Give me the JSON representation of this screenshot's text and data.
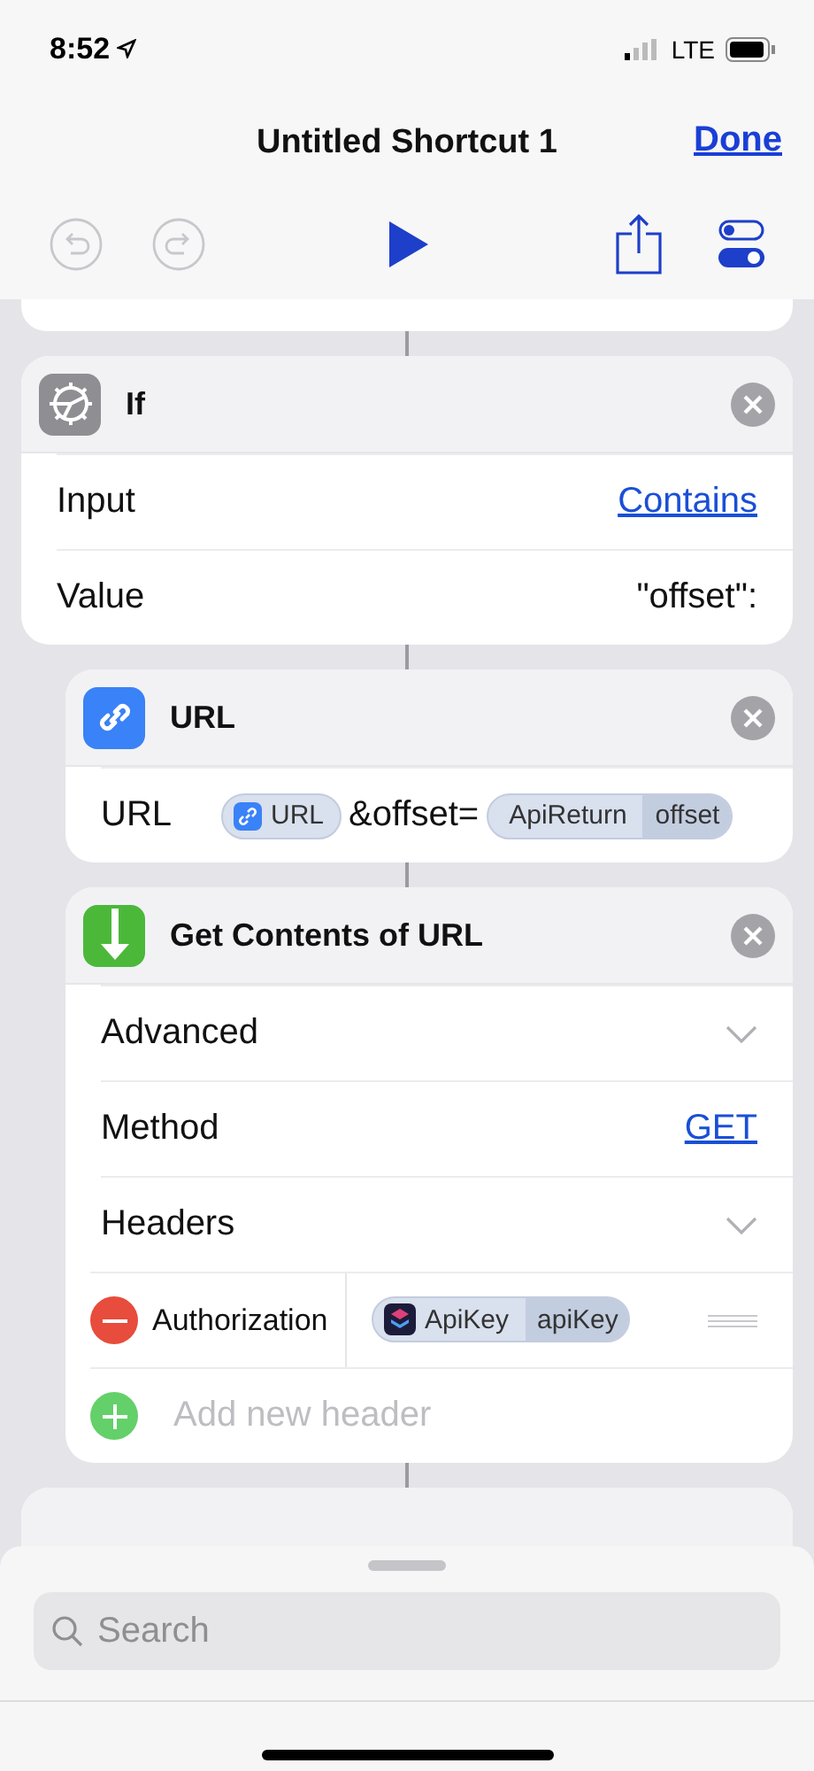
{
  "status_bar": {
    "time": "8:52",
    "network": "LTE"
  },
  "nav": {
    "title": "Untitled Shortcut 1",
    "done": "Done"
  },
  "toolbar": [
    {
      "kind": "undo",
      "disabled": true
    },
    {
      "kind": "redo",
      "disabled": true
    },
    {
      "kind": "play",
      "disabled": false
    },
    {
      "kind": "share",
      "disabled": false
    },
    {
      "kind": "settings",
      "disabled": false
    }
  ],
  "actions": [
    {
      "kind": "if",
      "title": "If",
      "color": "#8e8e93",
      "rows": [
        {
          "kind": "value",
          "label": "Input",
          "value": "Contains",
          "link": true
        },
        {
          "kind": "value",
          "label": "Value",
          "value": "\"offset\":",
          "link": false
        }
      ],
      "children": [
        {
          "kind": "url",
          "title": "URL",
          "color": "#3a82f7",
          "rows": [
            {
              "kind": "tokens",
              "label": "URL",
              "parts": [
                {
                  "kind": "link_variable",
                  "name": "URL"
                },
                {
                  "kind": "text",
                  "text": "&offset="
                },
                {
                  "kind": "variable",
                  "name": "ApiReturn",
                  "property": "offset"
                }
              ]
            }
          ]
        },
        {
          "kind": "download",
          "title": "Get Contents of URL",
          "color": "#4cb83a",
          "rows": [
            {
              "kind": "disclosure",
              "label": "Advanced"
            },
            {
              "kind": "value",
              "label": "Method",
              "value": "GET",
              "link": true
            },
            {
              "kind": "disclosure",
              "label": "Headers"
            },
            {
              "kind": "header",
              "key": "Authorization",
              "value": {
                "kind": "app_variable",
                "name": "ApiKey",
                "property": "apiKey"
              }
            },
            {
              "kind": "add",
              "placeholder": "Add new header"
            }
          ]
        }
      ]
    }
  ],
  "search": {
    "placeholder": "Search"
  }
}
